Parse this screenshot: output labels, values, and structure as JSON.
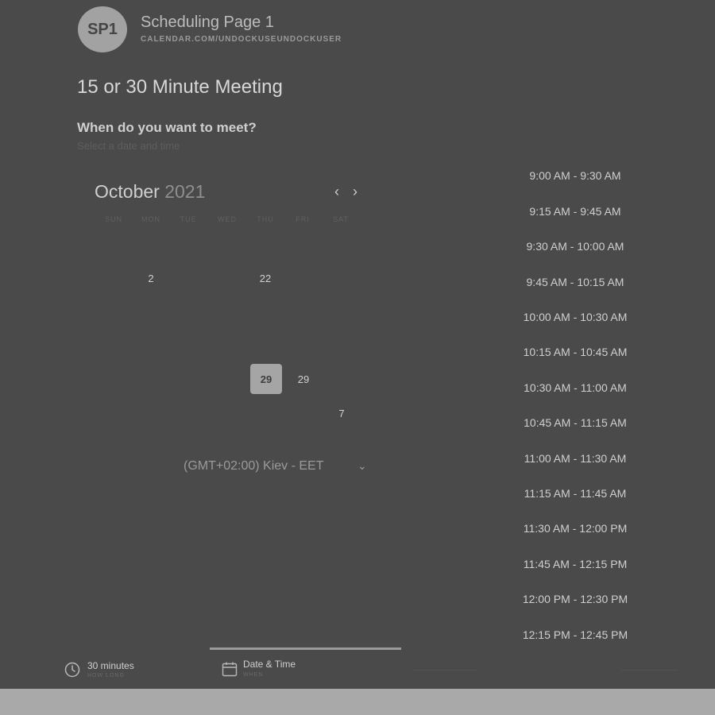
{
  "header": {
    "avatar_initials": "SP1",
    "page_name": "Scheduling Page 1",
    "page_url": "CALENDAR.COM/UNDOCKUSEUNDOCKUSER"
  },
  "meeting": {
    "title": "15 or 30 Minute Meeting",
    "question": "When do you want to meet?",
    "instruction": "Select a date and time"
  },
  "calendar": {
    "month": "October",
    "year": "2021",
    "weekdays": [
      "SUN",
      "MON",
      "TUE",
      "WED",
      "THU",
      "FRI",
      "SAT"
    ],
    "prev_icon": "chevron-left-icon",
    "next_icon": "chevron-right-icon",
    "days": [
      {
        "label": "2"
      },
      {
        "label": "22"
      },
      {
        "label": "29",
        "selected": true
      },
      {
        "label": "29"
      },
      {
        "label": "7"
      }
    ]
  },
  "timezone": {
    "label": "(GMT+02:00) Kiev - EET",
    "icon": "chevron-down-icon"
  },
  "time_slots": [
    "9:00 AM - 9:30 AM",
    "9:15 AM - 9:45 AM",
    "9:30 AM - 10:00 AM",
    "9:45 AM - 10:15 AM",
    "10:00 AM - 10:30 AM",
    "10:15 AM - 10:45 AM",
    "10:30 AM - 11:00 AM",
    "10:45 AM - 11:15 AM",
    "11:00 AM - 11:30 AM",
    "11:15 AM - 11:45 AM",
    "11:30 AM - 12:00 PM",
    "11:45 AM - 12:15 PM",
    "12:00 PM - 12:30 PM",
    "12:15 PM - 12:45 PM"
  ],
  "steps": {
    "duration_title": "30 minutes",
    "duration_sub": "HOW LONG",
    "datetime_title": "Date & Time",
    "datetime_sub": "WHEN"
  },
  "colors": {
    "background": "#4a4a4a",
    "selected_day": "#a5a5a5",
    "bottom_strip": "#a9a9a9"
  }
}
